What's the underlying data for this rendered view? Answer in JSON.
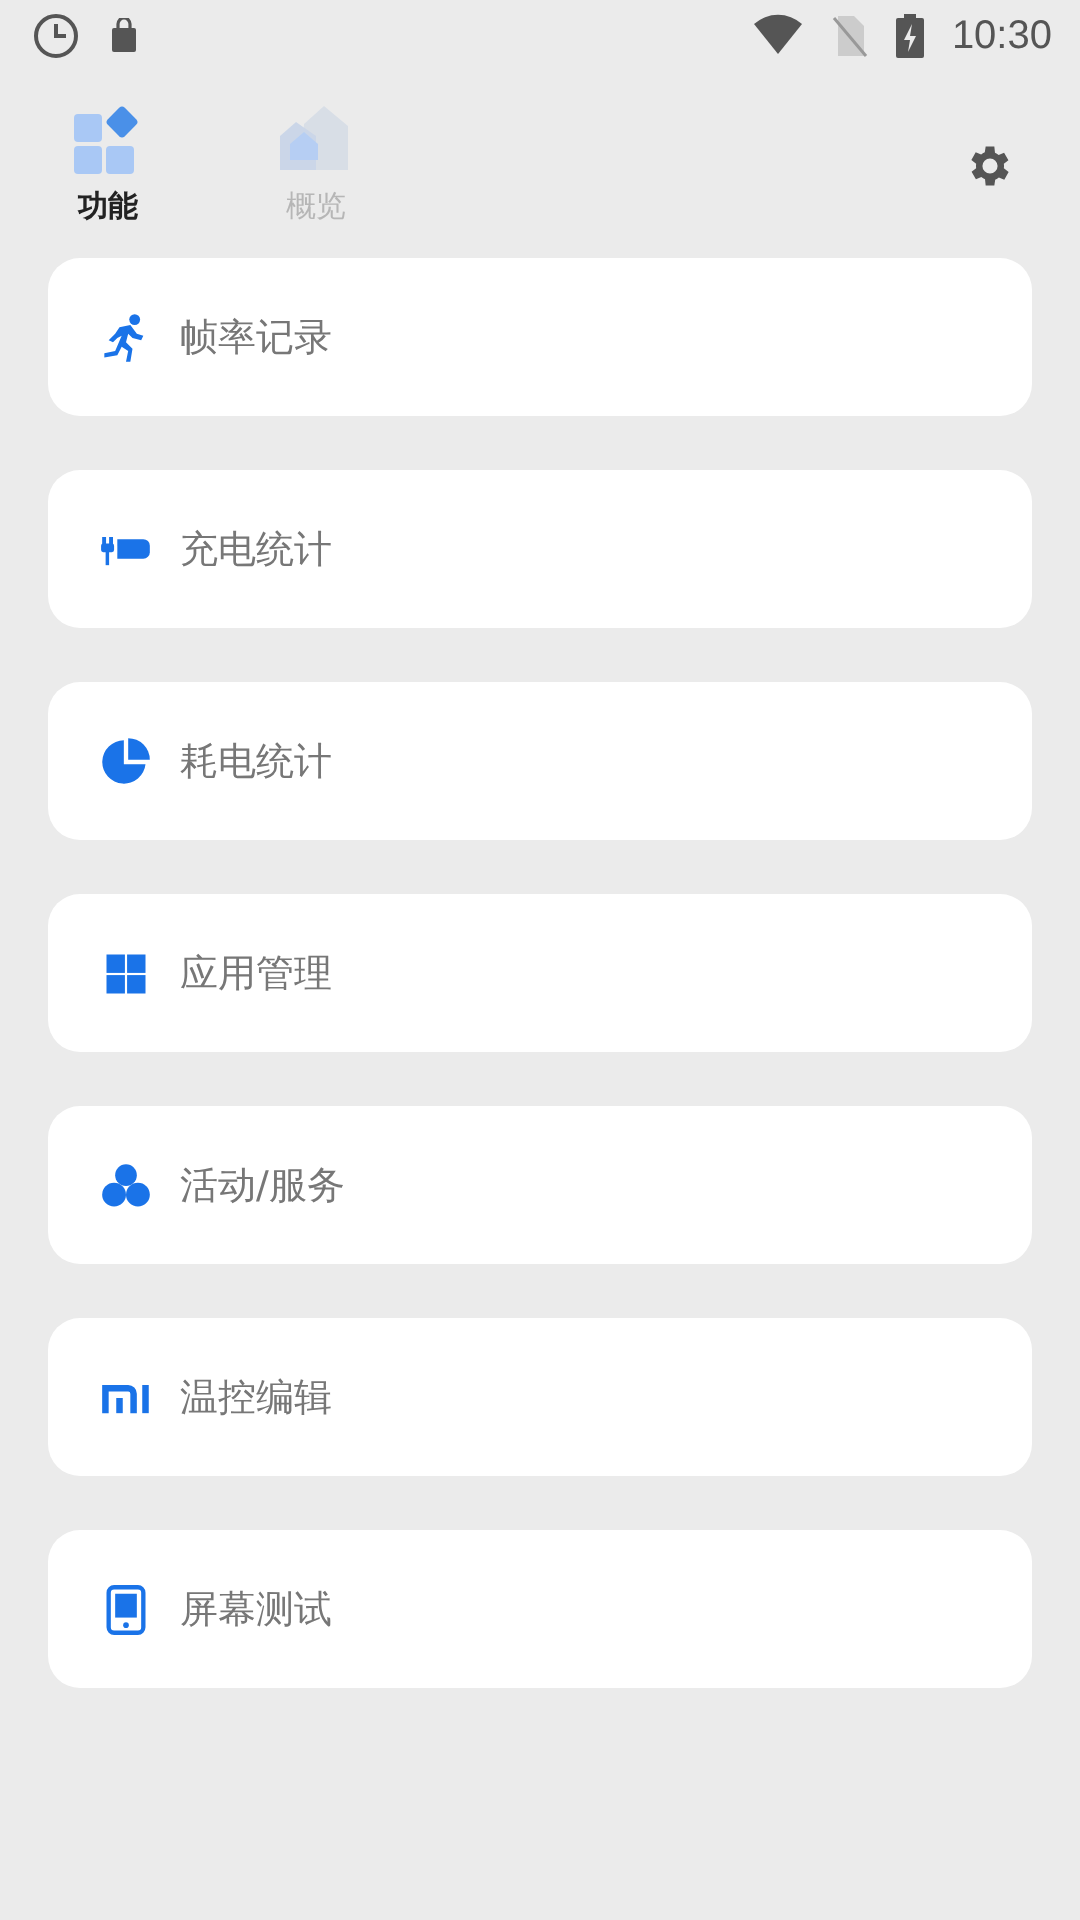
{
  "status_bar": {
    "time": "10:30"
  },
  "tabs": [
    {
      "label": "功能",
      "kind": "grid",
      "selected": true
    },
    {
      "label": "概览",
      "kind": "house",
      "selected": false
    }
  ],
  "items": [
    {
      "label": "帧率记录",
      "kind": "run"
    },
    {
      "label": "充电统计",
      "kind": "plug"
    },
    {
      "label": "耗电统计",
      "kind": "pie"
    },
    {
      "label": "应用管理",
      "kind": "apps"
    },
    {
      "label": "活动/服务",
      "kind": "circles"
    },
    {
      "label": "温控编辑",
      "kind": "mi"
    },
    {
      "label": "屏幕测试",
      "kind": "tablet"
    }
  ]
}
